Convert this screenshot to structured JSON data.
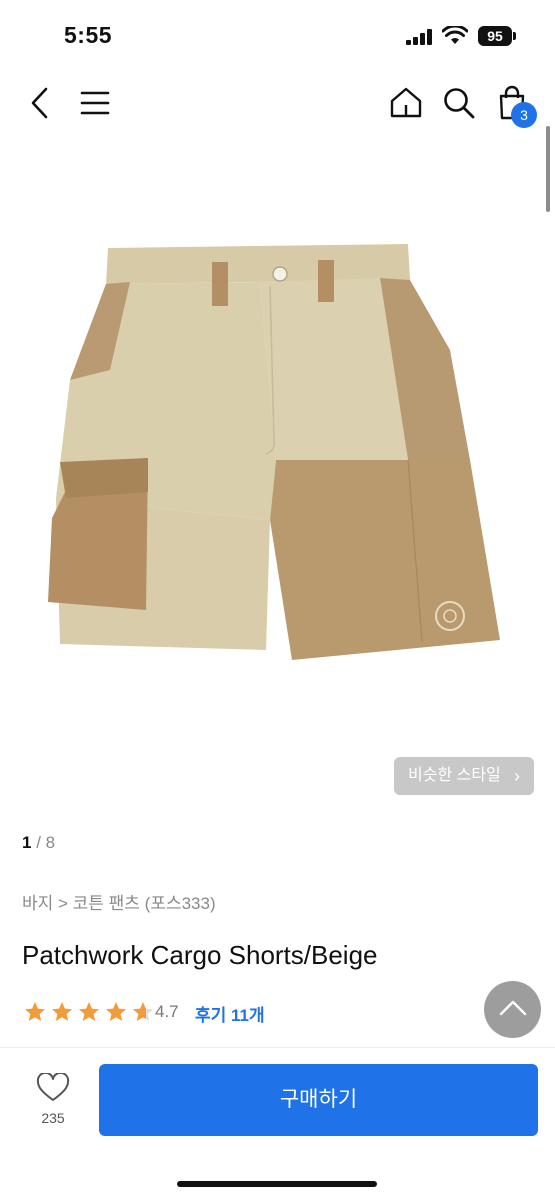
{
  "status_bar": {
    "time": "5:55",
    "battery": "95"
  },
  "nav": {
    "cart_count": "3"
  },
  "product": {
    "similar_style_label": "비슷한 스타일",
    "pager_current": "1",
    "pager_sep": " / ",
    "pager_total": "8",
    "breadcrumb": "바지 > 코튼 팬츠 (포스333)",
    "title": "Patchwork Cargo Shorts/Beige",
    "rating_value": "4.7",
    "rating_stars": 4.7,
    "review_label": "후기 11개"
  },
  "bottom_bar": {
    "like_count": "235",
    "buy_label": "구매하기"
  },
  "colors": {
    "accent": "#1f72e8",
    "star": "#f29b3a",
    "short_light": "#d9cfad",
    "short_dark": "#b9966a"
  }
}
